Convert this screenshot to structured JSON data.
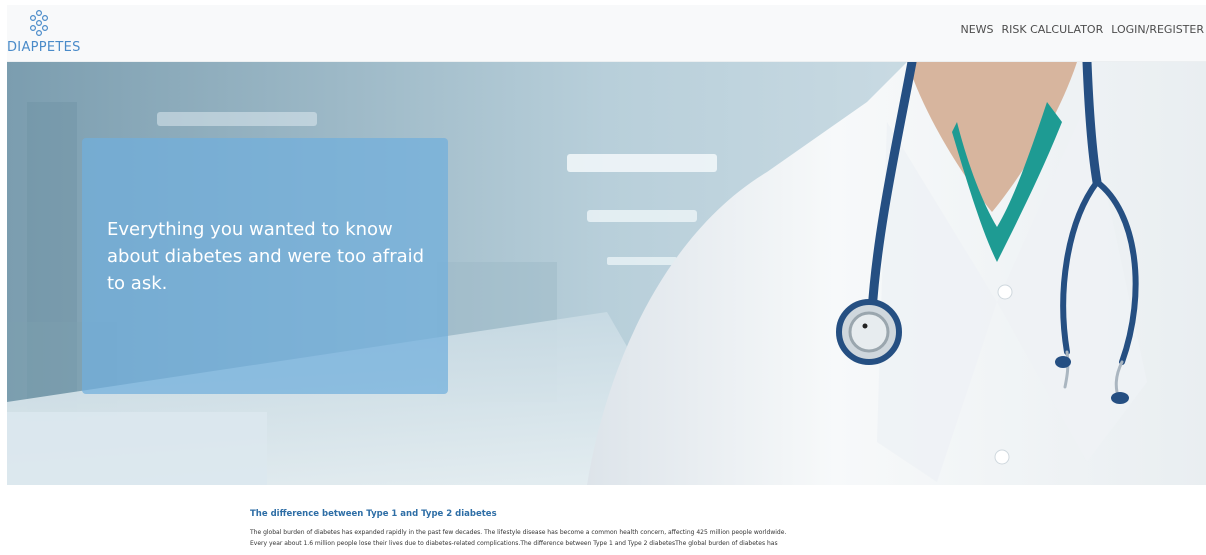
{
  "header": {
    "logo_text": "DIAPPETES",
    "nav": [
      {
        "label": "NEWS"
      },
      {
        "label": "RISK CALCULATOR"
      },
      {
        "label": "LOGIN/REGISTER"
      }
    ]
  },
  "hero": {
    "headline": "Everything you wanted to know about diabetes and were too afraid to ask."
  },
  "article": {
    "title": "The difference between Type 1 and Type 2 diabetes",
    "body_lines": [
      "The global burden of diabetes has expanded rapidly in the past few decades. The lifestyle disease has become a common health concern, affecting 425 million people worldwide.",
      "Every year about 1.6 million people lose their lives due to diabetes-related complications.The difference between Type 1 and Type 2 diabetesThe global burden of diabetes has"
    ]
  },
  "colors": {
    "brand": "#4a8bc9",
    "hero_card": "#70aedc",
    "article_title": "#2e6ea6"
  }
}
